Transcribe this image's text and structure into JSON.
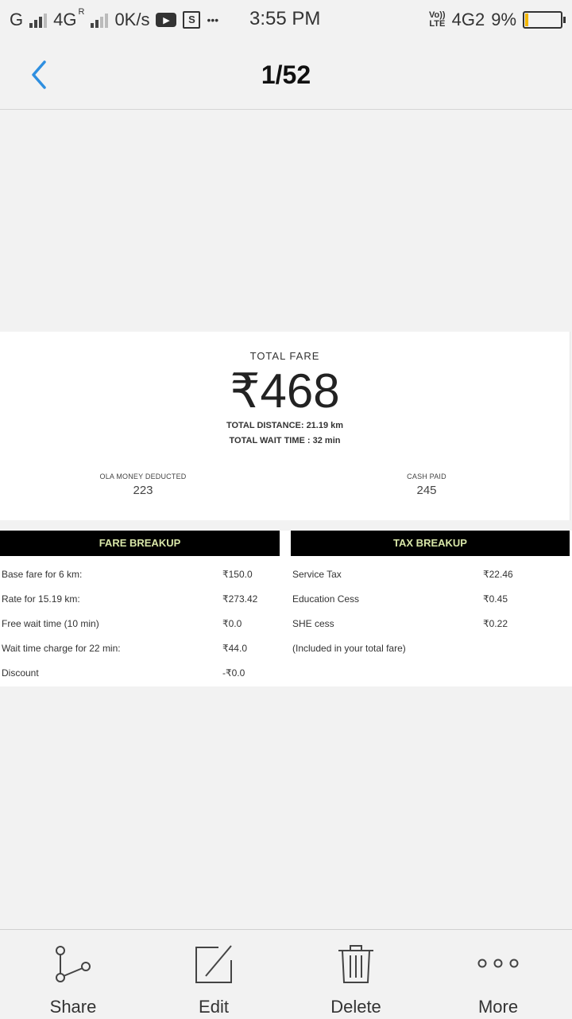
{
  "status_bar": {
    "carrier1": "G",
    "carrier2": "4G",
    "roaming": "R",
    "speed": "0K/s",
    "s_icon": "S",
    "dots": "•••",
    "time": "3:55 PM",
    "volte_top": "Vo))",
    "volte_bottom": "LTE",
    "net": "4G2",
    "battery": "9%",
    "battery_level": 0.09
  },
  "header": {
    "title": "1/52"
  },
  "receipt": {
    "total_label": "TOTAL FARE",
    "total_amount": "₹468",
    "distance": "TOTAL DISTANCE: 21.19 km",
    "wait_time": "TOTAL WAIT TIME : 32 min",
    "ola_money_label": "OLA MONEY DEDUCTED",
    "ola_money_value": "223",
    "cash_label": "CASH PAID",
    "cash_value": "245",
    "fare_header": "FARE BREAKUP",
    "tax_header": "TAX BREAKUP",
    "fare_rows": [
      {
        "label": "Base fare for 6 km:",
        "value": "₹150.0"
      },
      {
        "label": "Rate for 15.19 km:",
        "value": "₹273.42"
      },
      {
        "label": "Free wait time (10 min)",
        "value": "₹0.0"
      },
      {
        "label": "Wait time charge for 22 min:",
        "value": "₹44.0"
      },
      {
        "label": "Discount",
        "value": "-₹0.0"
      }
    ],
    "tax_rows": [
      {
        "label": "Service Tax",
        "value": "₹22.46"
      },
      {
        "label": "Education Cess",
        "value": "₹0.45"
      },
      {
        "label": "SHE cess",
        "value": "₹0.22"
      },
      {
        "label": "(Included in your total fare)",
        "value": ""
      }
    ]
  },
  "toolbar": {
    "share": "Share",
    "edit": "Edit",
    "delete": "Delete",
    "more": "More"
  },
  "colors": {
    "accent": "#2f8fe0",
    "bar_bg": "#000000",
    "bar_text": "#d8e6a8",
    "background": "#f2f2f2"
  }
}
